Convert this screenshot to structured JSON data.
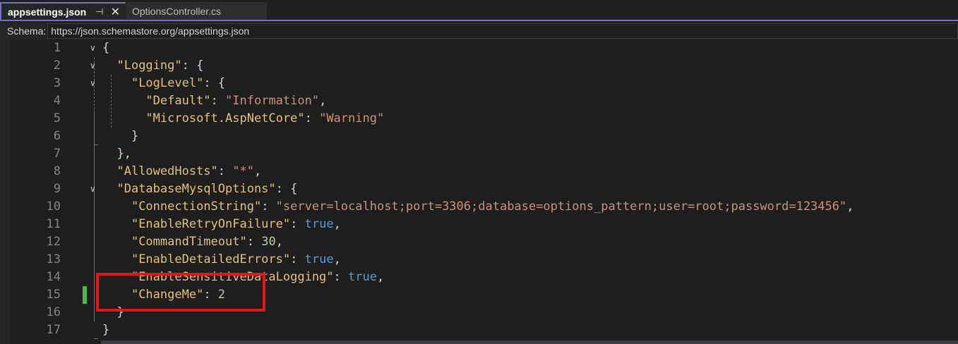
{
  "tabs": [
    {
      "label": "appsettings.json",
      "active": true
    },
    {
      "label": "OptionsController.cs",
      "active": false
    }
  ],
  "pin_icon": "pin-icon",
  "close_icon": "close-icon",
  "schema": {
    "label": "Schema:",
    "url": "https://json.schemastore.org/appsettings.json"
  },
  "editor": {
    "lines": [
      {
        "n": "1"
      },
      {
        "n": "2"
      },
      {
        "n": "3"
      },
      {
        "n": "4"
      },
      {
        "n": "5"
      },
      {
        "n": "6"
      },
      {
        "n": "7"
      },
      {
        "n": "8"
      },
      {
        "n": "9"
      },
      {
        "n": "10"
      },
      {
        "n": "11"
      },
      {
        "n": "12"
      },
      {
        "n": "13"
      },
      {
        "n": "14"
      },
      {
        "n": "15"
      },
      {
        "n": "16"
      },
      {
        "n": "17"
      }
    ],
    "tokens": {
      "l1_open": "{",
      "logging_key": "\"Logging\"",
      "loglevel_key": "\"LogLevel\"",
      "default_key": "\"Default\"",
      "default_val": "\"Information\"",
      "aspnet_key": "\"Microsoft.AspNetCore\"",
      "aspnet_val": "\"Warning\"",
      "allowedhosts_key": "\"AllowedHosts\"",
      "allowedhosts_val": "\"*\"",
      "dbopts_key": "\"DatabaseMysqlOptions\"",
      "connstr_key": "\"ConnectionString\"",
      "connstr_val": "\"server=localhost;port=3306;database=options_pattern;user=root;password=123456\"",
      "retry_key": "\"EnableRetryOnFailure\"",
      "retry_val": "true",
      "timeout_key": "\"CommandTimeout\"",
      "timeout_val": "30",
      "detailed_key": "\"EnableDetailedErrors\"",
      "detailed_val": "true",
      "sensitive_key": "\"EnableSensitiveDataLogging\"",
      "sensitive_val": "true",
      "changeme_key": "\"ChangeMe\"",
      "changeme_val": "2",
      "close_brace": "}"
    }
  },
  "colors": {
    "accent": "#6f6fd8",
    "key": "#e6c07b",
    "string": "#ce9178",
    "keyword": "#569cd6",
    "number": "#b5cea8",
    "change_marker": "#4fb54f",
    "highlight_box": "#e0171d"
  }
}
